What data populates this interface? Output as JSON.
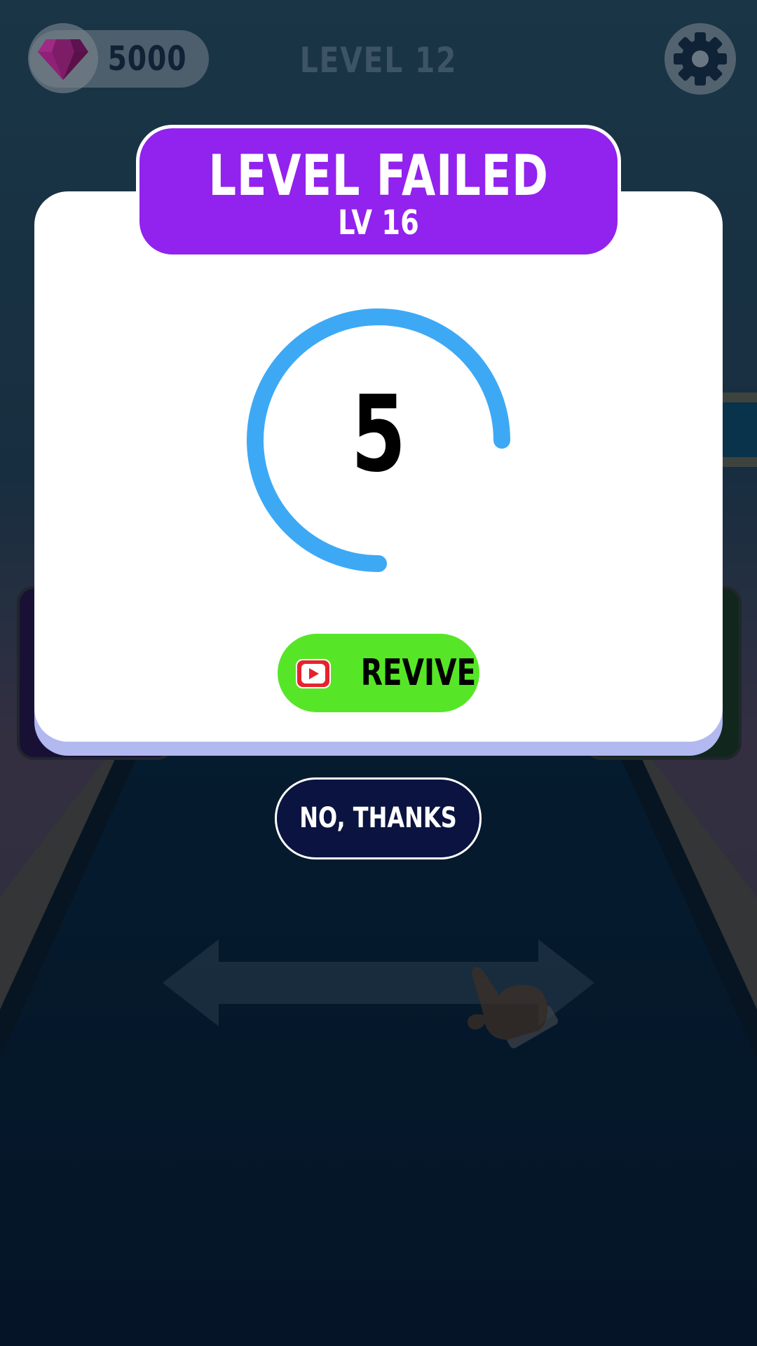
{
  "hud": {
    "gem_count": "5000",
    "level_title": "LEVEL 12",
    "gem_icon": "gem-icon",
    "settings_icon": "gear-icon"
  },
  "modal": {
    "title": "LEVEL FAILED",
    "subtitle": "LV 16",
    "countdown": "5",
    "countdown_progress": 0.75,
    "revive_label": "REVIVE",
    "revive_icon": "video-play-icon",
    "no_thanks_label": "NO, THANKS"
  },
  "background": {
    "hint_icons": [
      "double-arrow-icon",
      "pointing-hand-icon"
    ]
  },
  "colors": {
    "banner": "#9222ee",
    "timer_ring": "#3da9f5",
    "revive_button": "#57e627",
    "no_thanks_button": "#0b1440",
    "play_icon": "#e5232d"
  }
}
